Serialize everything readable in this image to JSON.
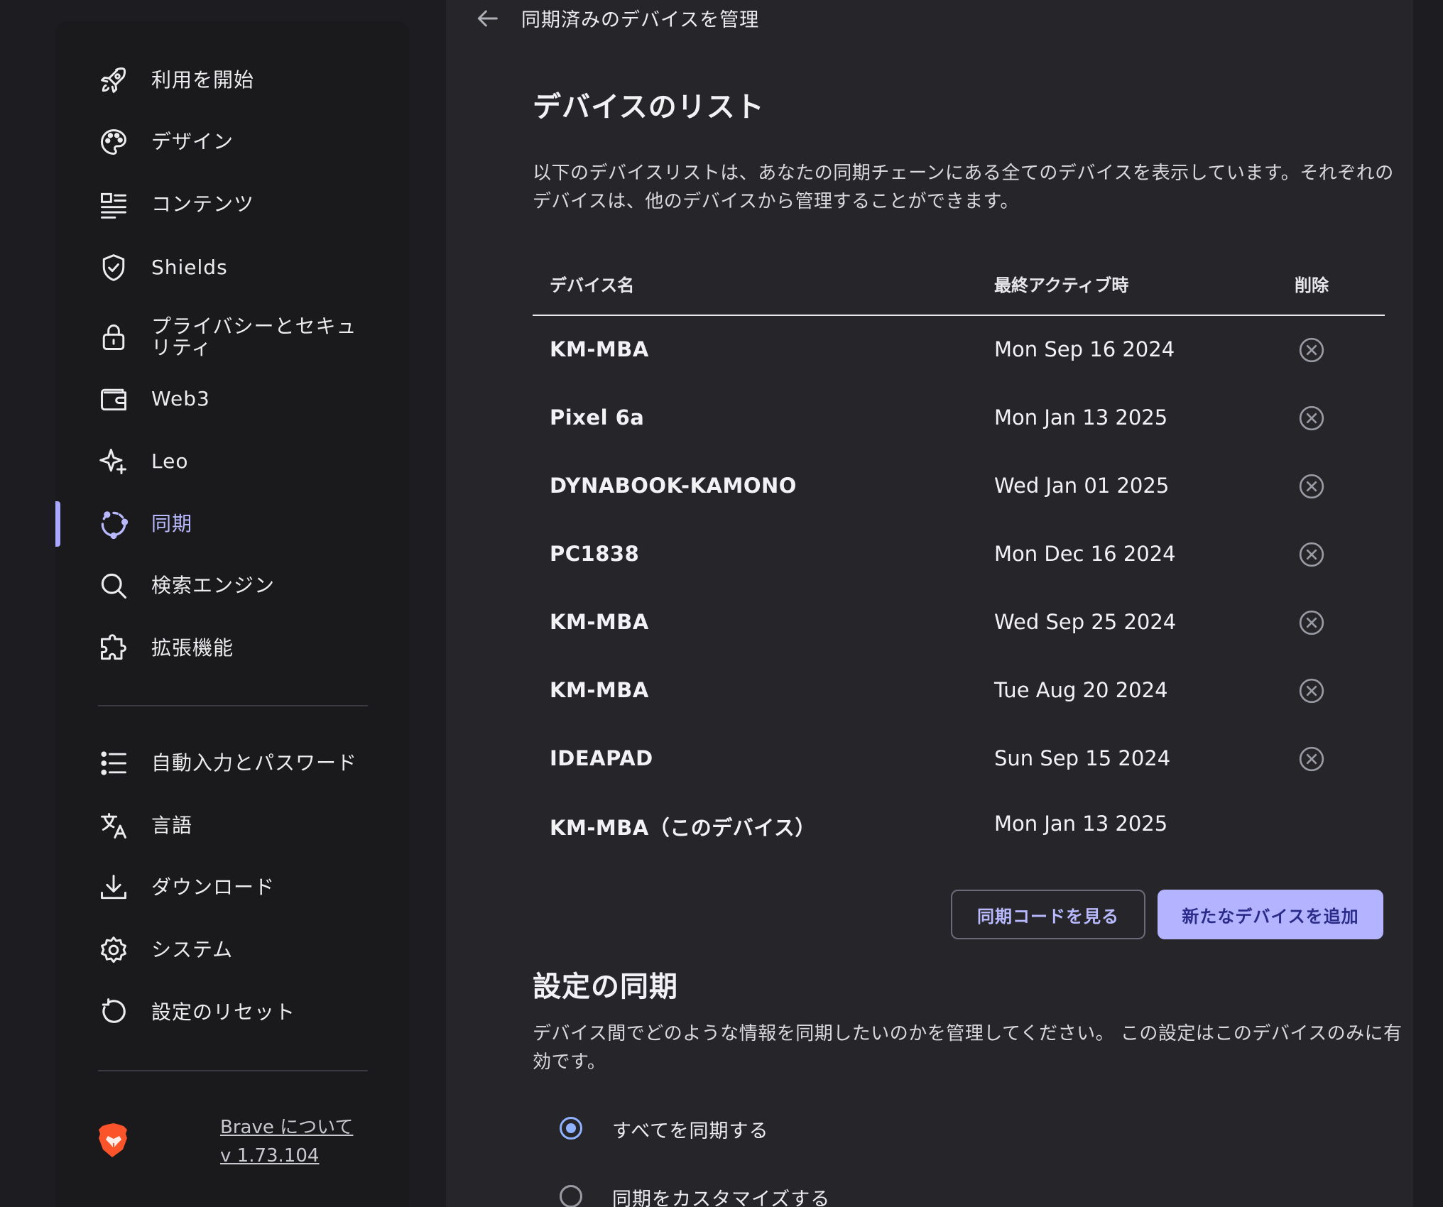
{
  "sidebar": {
    "items": [
      {
        "label": "利用を開始",
        "icon": "rocket-icon"
      },
      {
        "label": "デザイン",
        "icon": "palette-icon"
      },
      {
        "label": "コンテンツ",
        "icon": "content-icon"
      },
      {
        "label": "Shields",
        "icon": "shield-icon"
      },
      {
        "label": "プライバシーとセキュリティ",
        "icon": "lock-icon"
      },
      {
        "label": "Web3",
        "icon": "wallet-icon"
      },
      {
        "label": "Leo",
        "icon": "sparkle-icon"
      },
      {
        "label": "同期",
        "icon": "sync-icon"
      },
      {
        "label": "検索エンジン",
        "icon": "search-icon"
      },
      {
        "label": "拡張機能",
        "icon": "puzzle-icon"
      },
      {
        "label": "自動入力とパスワード",
        "icon": "list-icon"
      },
      {
        "label": "言語",
        "icon": "translate-icon"
      },
      {
        "label": "ダウンロード",
        "icon": "download-icon"
      },
      {
        "label": "システム",
        "icon": "gear-icon"
      },
      {
        "label": "設定のリセット",
        "icon": "reset-icon"
      }
    ],
    "active_label": "同期",
    "about_label": "Brave について",
    "version": "v 1.73.104"
  },
  "topbar": {
    "title": "同期済みのデバイスを管理"
  },
  "devices": {
    "title": "デバイスのリスト",
    "description": "以下のデバイスリストは、あなたの同期チェーンにある全てのデバイスを表示しています。それぞれのデバイスは、他のデバイスから管理することができます。",
    "columns": {
      "name": "デバイス名",
      "last_active": "最終アクティブ時",
      "delete": "削除"
    },
    "rows": [
      {
        "name": "KM-MBA",
        "date": "Mon Sep 16 2024"
      },
      {
        "name": "Pixel 6a",
        "date": "Mon Jan 13 2025"
      },
      {
        "name": "DYNABOOK-KAMONO",
        "date": "Wed Jan 01 2025"
      },
      {
        "name": "PC1838",
        "date": "Mon Dec 16 2024"
      },
      {
        "name": "KM-MBA",
        "date": "Wed Sep 25 2024"
      },
      {
        "name": "KM-MBA",
        "date": "Tue Aug 20 2024"
      },
      {
        "name": "IDEAPAD",
        "date": "Sun Sep 15 2024"
      },
      {
        "name": "KM-MBA（このデバイス）",
        "date": "Mon Jan 13 2025"
      }
    ],
    "view_code_button": "同期コードを見る",
    "add_device_button": "新たなデバイスを追加"
  },
  "sync_settings": {
    "title": "設定の同期",
    "description": "デバイス間でどのような情報を同期したいのかを管理してください。 この設定はこのデバイスのみに有効です。",
    "options": [
      {
        "label": "すべてを同期する",
        "selected": true
      },
      {
        "label": "同期をカスタマイズする",
        "selected": false
      }
    ]
  },
  "colors": {
    "accent": "#b3b3ff",
    "radio": "#8fb1ff",
    "sidebar_bg": "#1a1a1d",
    "main_bg": "#26262a"
  }
}
